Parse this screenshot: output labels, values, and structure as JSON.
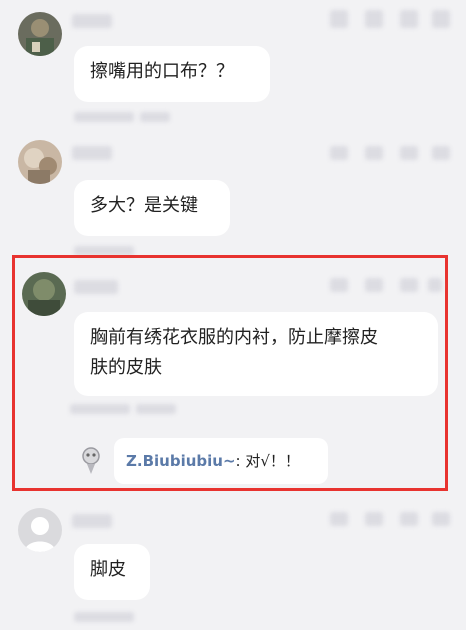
{
  "posts": [
    {
      "message": "擦嘴用的口布？？"
    },
    {
      "message": "多大？是关键"
    },
    {
      "message_line1": "胸前有绣花衣服的内衬，防止摩擦皮",
      "message_line2": "肤的皮肤",
      "reply": {
        "name": "Z.Biubiubiu~",
        "sep": ": ",
        "text": "对√！！"
      }
    },
    {
      "message": "脚皮"
    }
  ],
  "colors": {
    "highlight": "#e8332f",
    "reply_name": "#5b7aa8",
    "background": "#f2f2f4"
  },
  "icons": [
    "avatar-icon",
    "small-avatar-icon"
  ]
}
